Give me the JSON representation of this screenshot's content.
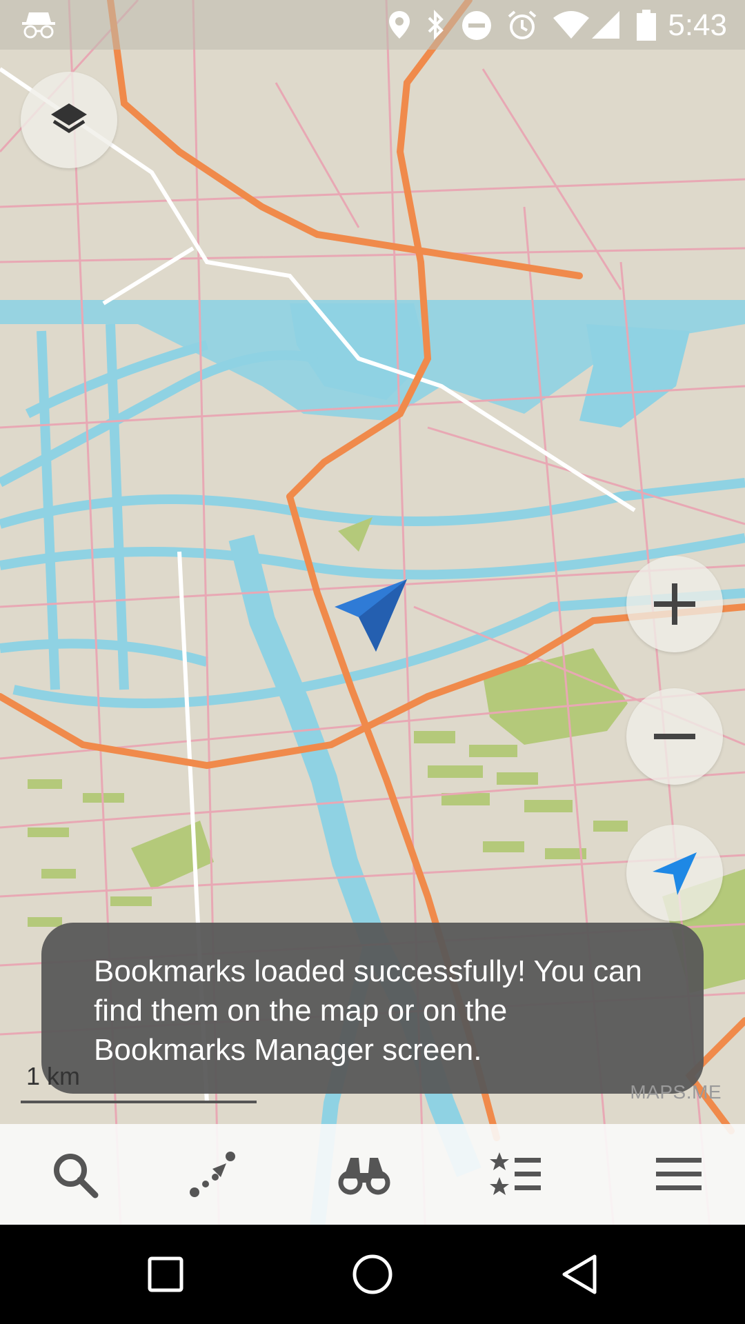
{
  "status_bar": {
    "time": "5:43",
    "icons": [
      "incognito-icon",
      "location-pin-icon",
      "bluetooth-icon",
      "do-not-disturb-icon",
      "alarm-icon",
      "wifi-icon",
      "cellular-signal-icon",
      "battery-icon"
    ]
  },
  "map": {
    "scale_label": "1 km",
    "brand": "MAPS.ME",
    "controls": [
      "layers-icon",
      "zoom-in-icon",
      "zoom-out-icon",
      "my-location-icon"
    ],
    "colors": {
      "land": "#ded9cb",
      "water": "#8fd2e3",
      "park": "#b4c97a",
      "major_road": "#f08a4b",
      "minor_road": "#e8a8b4",
      "position_arrow": "#2f7bd6"
    }
  },
  "toast": {
    "message": "Bookmarks loaded successfully! You can find them on the map or on the Bookmarks Manager screen."
  },
  "bottom_nav": {
    "items": [
      "search-icon",
      "route-icon",
      "discovery-binoculars-icon",
      "bookmarks-icon",
      "menu-icon"
    ]
  },
  "system_nav": {
    "items": [
      "recents-icon",
      "home-icon",
      "back-icon"
    ]
  }
}
